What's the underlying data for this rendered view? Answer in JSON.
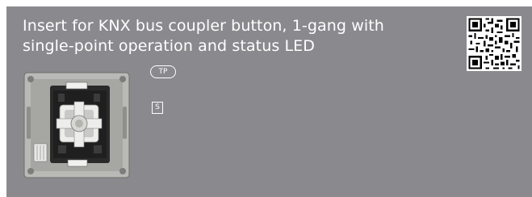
{
  "header": {
    "title_line1": "Insert for KNX bus coupler button, 1-gang with",
    "title_line2": "single-point operation and status LED"
  },
  "badges": {
    "tp": "TP",
    "s": "S"
  },
  "icons": {
    "qr": "qr-code-icon",
    "product": "product-photo"
  },
  "colors": {
    "panel_background": "#8a8a8e",
    "text": "#ffffff"
  }
}
